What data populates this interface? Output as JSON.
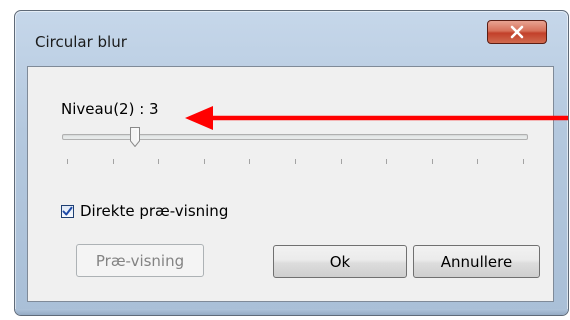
{
  "window": {
    "title": "Circular blur"
  },
  "level": {
    "label": "Niveau(2) : 3",
    "value": 3,
    "min": 0,
    "max": 20
  },
  "slider": {
    "tick_count": 11
  },
  "checkbox": {
    "label": "Direkte præ-visning",
    "checked": true
  },
  "buttons": {
    "preview_label": "Præ-visning",
    "ok_label": "Ok",
    "cancel_label": "Annullere"
  },
  "icons": {
    "close": "close-icon",
    "check": "checkmark-icon",
    "annotation": "red-arrow-icon"
  },
  "colors": {
    "close_button": "#c2402a",
    "checkbox_border": "#1e3f72",
    "check_mark": "#1e4aa8",
    "annotation_arrow": "#ff0000"
  }
}
